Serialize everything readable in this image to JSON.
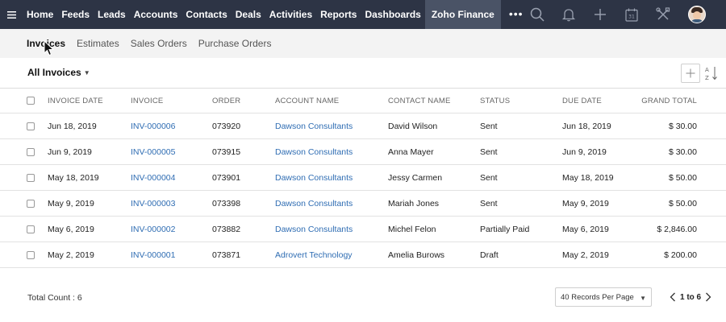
{
  "nav": {
    "items": [
      "Home",
      "Feeds",
      "Leads",
      "Accounts",
      "Contacts",
      "Deals",
      "Activities",
      "Reports",
      "Dashboards"
    ],
    "active_label": "Zoho Finance",
    "more_label": "•••",
    "icons": [
      "search-icon",
      "bell-icon",
      "plus-icon",
      "calendar-icon",
      "tools-icon",
      "avatar"
    ]
  },
  "subtabs": {
    "items": [
      "Invoices",
      "Estimates",
      "Sales Orders",
      "Purchase Orders"
    ],
    "active_index": 0
  },
  "toolbar": {
    "view_label": "All Invoices"
  },
  "table": {
    "columns": [
      "INVOICE DATE",
      "INVOICE",
      "ORDER",
      "ACCOUNT NAME",
      "CONTACT NAME",
      "STATUS",
      "DUE DATE",
      "GRAND TOTAL"
    ],
    "rows": [
      {
        "date": "Jun 18, 2019",
        "invoice": "INV-000006",
        "order": "073920",
        "account": "Dawson Consultants",
        "contact": "David Wilson",
        "status": "Sent",
        "due": "Jun 18, 2019",
        "total": "$ 30.00"
      },
      {
        "date": "Jun 9, 2019",
        "invoice": "INV-000005",
        "order": "073915",
        "account": "Dawson Consultants",
        "contact": "Anna Mayer",
        "status": "Sent",
        "due": "Jun 9, 2019",
        "total": "$ 30.00"
      },
      {
        "date": "May 18, 2019",
        "invoice": "INV-000004",
        "order": "073901",
        "account": "Dawson Consultants",
        "contact": "Jessy Carmen",
        "status": "Sent",
        "due": "May 18, 2019",
        "total": "$ 50.00"
      },
      {
        "date": "May 9, 2019",
        "invoice": "INV-000003",
        "order": "073398",
        "account": "Dawson Consultants",
        "contact": "Mariah Jones",
        "status": "Sent",
        "due": "May 9, 2019",
        "total": "$ 50.00"
      },
      {
        "date": "May 6, 2019",
        "invoice": "INV-000002",
        "order": "073882",
        "account": "Dawson Consultants",
        "contact": "Michel Felon",
        "status": "Partially Paid",
        "due": "May 6, 2019",
        "total": "$ 2,846.00"
      },
      {
        "date": "May 2, 2019",
        "invoice": "INV-000001",
        "order": "073871",
        "account": "Adrovert Technology",
        "contact": "Amelia Burows",
        "status": "Draft",
        "due": "May 2, 2019",
        "total": "$ 200.00"
      }
    ]
  },
  "footer": {
    "total_count": "Total Count : 6",
    "per_page": "40 Records Per Page",
    "range": "1 to 6"
  },
  "colors": {
    "nav_bg": "#2d3445",
    "nav_active_bg": "#4a5366",
    "link": "#2f6db3",
    "subtab_bg": "#f3f3f3"
  }
}
